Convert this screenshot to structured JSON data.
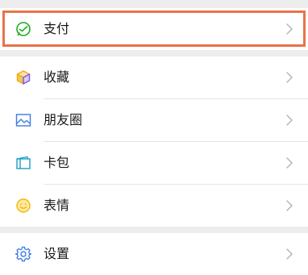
{
  "colors": {
    "background": "#ededed",
    "row_background": "#ffffff",
    "highlight": "#e8734a",
    "pay_icon": "#1aad19",
    "favorites_icon_top": "#f5a623",
    "favorites_icon_side": "#7b5bd6",
    "moments_icon": "#3d7be6",
    "cards_icon": "#1aa0c8",
    "stickers_icon": "#f5b800",
    "settings_icon": "#3d7be6",
    "chevron": "#b2b2b2"
  },
  "menu": {
    "pay": {
      "label": "支付",
      "icon": "pay-check-icon"
    },
    "favorites": {
      "label": "收藏",
      "icon": "cube-icon"
    },
    "moments": {
      "label": "朋友圈",
      "icon": "photo-icon"
    },
    "cards": {
      "label": "卡包",
      "icon": "wallet-card-icon"
    },
    "stickers": {
      "label": "表情",
      "icon": "smiley-icon"
    },
    "settings": {
      "label": "设置",
      "icon": "gear-icon"
    }
  }
}
